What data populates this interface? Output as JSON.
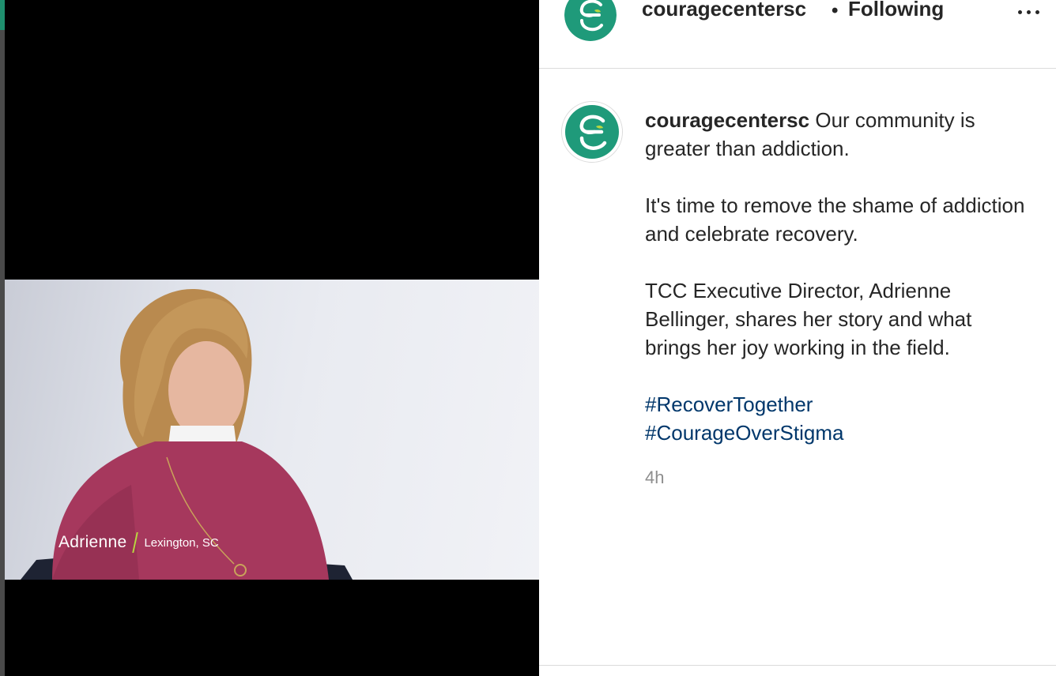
{
  "post": {
    "username": "couragecentersc",
    "follow_separator": "•",
    "follow_status": "Following",
    "caption_line1": "Our community is greater than addiction.",
    "caption_para2": "It's time to remove the shame of addiction and celebrate recovery.",
    "caption_para3": "TCC Executive Director, Adrienne Bellinger, shares her story and what brings her joy working in the field.",
    "hashtags": [
      "#RecoverTogether",
      "#CourageOverStigma"
    ],
    "timestamp": "4h"
  },
  "video": {
    "name_overlay": "Adrienne",
    "location_overlay": "Lexington, SC"
  },
  "colors": {
    "brand_teal": "#1f9a7a",
    "hashtag_blue": "#00376b",
    "accent_lime": "#b8d640"
  },
  "icons": {
    "logo": "courage-center-logo",
    "more": "more-options-icon"
  }
}
